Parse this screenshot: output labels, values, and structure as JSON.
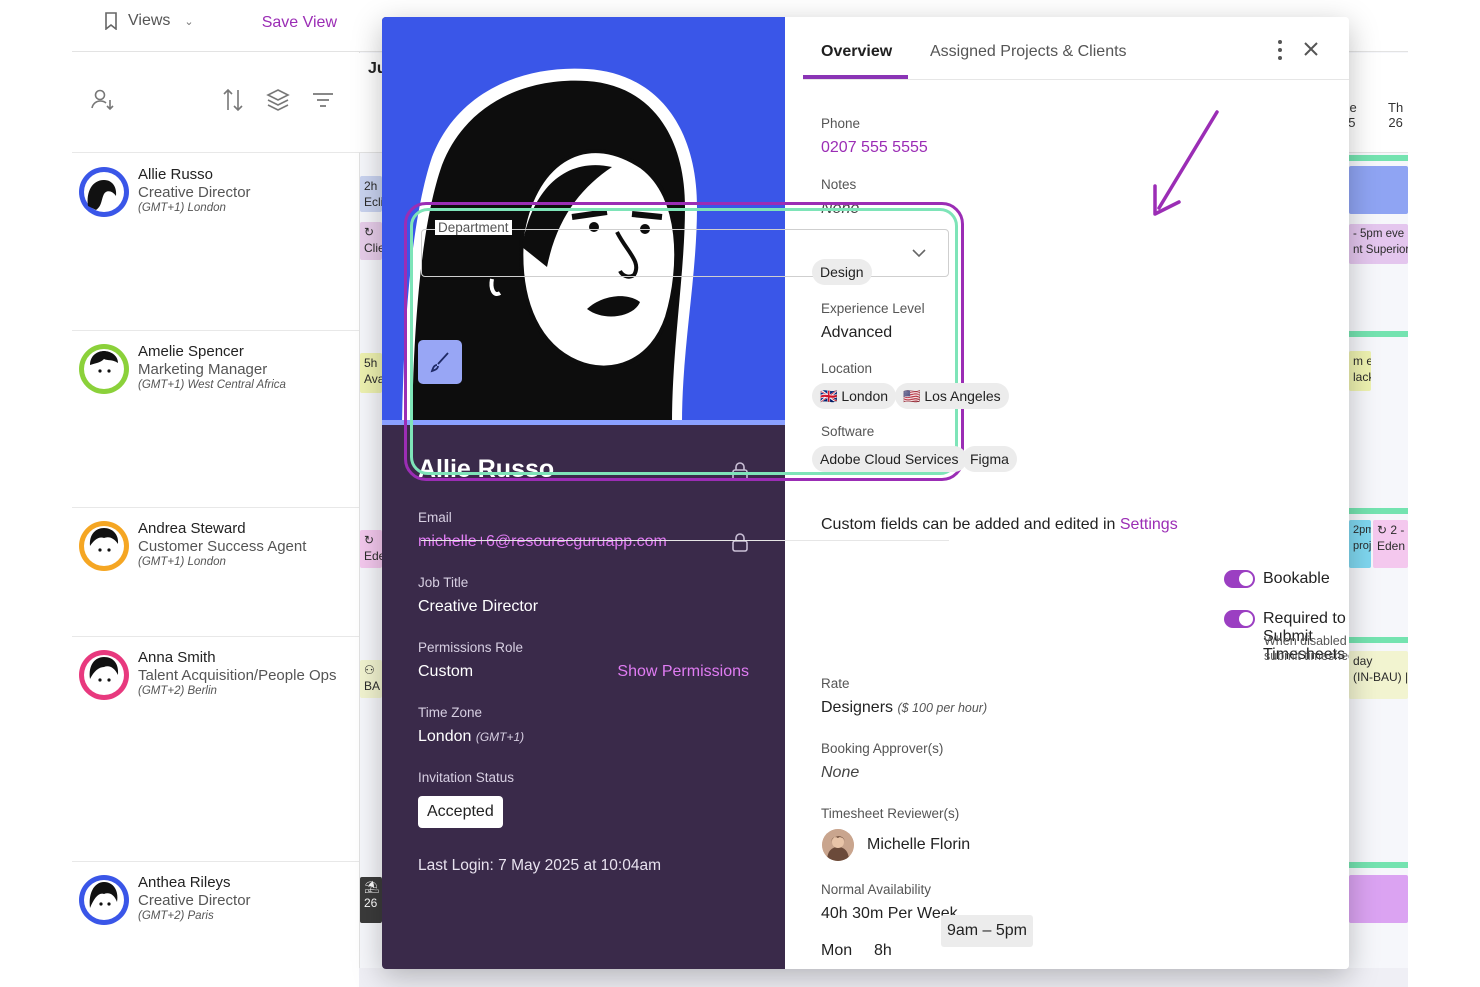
{
  "colors": {
    "accent": "#9b2db5",
    "modal_dark": "#3a2a4a",
    "portrait_bg": "#3a56e8",
    "highlight_green": "#7ee4b8",
    "toggle_on": "#9b3fc2"
  },
  "sidebar": {
    "views_label": "Views",
    "save_view_label": "Save View",
    "people": [
      {
        "name": "Allie Russo",
        "role": "Creative Director",
        "tz": "(GMT+1) London",
        "ring": "#3a56e8"
      },
      {
        "name": "Amelie Spencer",
        "role": "Marketing Manager",
        "tz": "(GMT+1) West Central Africa",
        "ring": "#8bd13a"
      },
      {
        "name": "Andrea Steward",
        "role": "Customer Success Agent",
        "tz": "(GMT+1) London",
        "ring": "#f5a623"
      },
      {
        "name": "Anna Smith",
        "role": "Talent Acquisition/People Ops",
        "tz": "(GMT+2) Berlin",
        "ring": "#e8397e"
      },
      {
        "name": "Anthea Rileys",
        "role": "Creative Director",
        "tz": "(GMT+2) Paris",
        "ring": "#3a56e8"
      }
    ]
  },
  "schedule": {
    "month": "Ju",
    "day_th": "Th",
    "day_26": "26",
    "day_frag_e": "'e",
    "day_frag_5": "5",
    "bk1a": "2h",
    "bk1b": "Ecli",
    "bk2": "Clie",
    "bk3a": "5h",
    "bk3b": "Ava",
    "bk4": "Ede",
    "bk5": "BA",
    "bk6": "26",
    "r1": "- 5pm eve",
    "r2": "nt Superior",
    "r3": "m e",
    "r4": "lack",
    "r5": "2pm",
    "r6": "proj",
    "r7": "2 -",
    "r8": "Eden (",
    "r9": "day",
    "r10": "(IN-BAU) |"
  },
  "profile": {
    "name": "Allie Russo",
    "email_label": "Email",
    "email": "michelle+6@resourecguruapp.com",
    "job_title_label": "Job Title",
    "job_title": "Creative Director",
    "permissions_label": "Permissions Role",
    "permissions": "Custom",
    "show_permissions": "Show Permissions",
    "timezone_label": "Time Zone",
    "timezone": "London",
    "timezone_sub": "(GMT+1)",
    "invitation_label": "Invitation Status",
    "invitation": "Accepted",
    "last_login": "Last Login: 7 May 2025 at 10:04am"
  },
  "tabs": {
    "overview": "Overview",
    "assigned": "Assigned Projects & Clients"
  },
  "details": {
    "phone_label": "Phone",
    "phone": "0207 555 5555",
    "notes_label": "Notes",
    "notes": "None",
    "department_label": "Department",
    "department": "Design",
    "experience_label": "Experience Level",
    "experience": "Advanced",
    "location_label": "Location",
    "loc_london": "🇬🇧 London",
    "loc_la": "🇺🇸 Los Angeles",
    "software_label": "Software",
    "sw_adobe": "Adobe Cloud Services",
    "sw_figma": "Figma",
    "custom_fields_text": "Custom fields can be added and edited in ",
    "settings_link": "Settings",
    "bookable": "Bookable",
    "timesheets": "Required to Submit Timesheets",
    "timesheets_help": "When disabled this person won't appear under \"Awaiting Submission\" but can still submit timesheets",
    "rate_label": "Rate",
    "rate": "Designers",
    "rate_sub": "($ 100 per hour)",
    "approver_label": "Booking Approver(s)",
    "approver": "None",
    "reviewer_label": "Timesheet Reviewer(s)",
    "reviewer": "Michelle Florin",
    "availability_label": "Normal Availability",
    "availability": "40h 30m Per Week",
    "mon": "Mon",
    "mon_hours": "8h",
    "mon_range": "9am – 5pm"
  }
}
